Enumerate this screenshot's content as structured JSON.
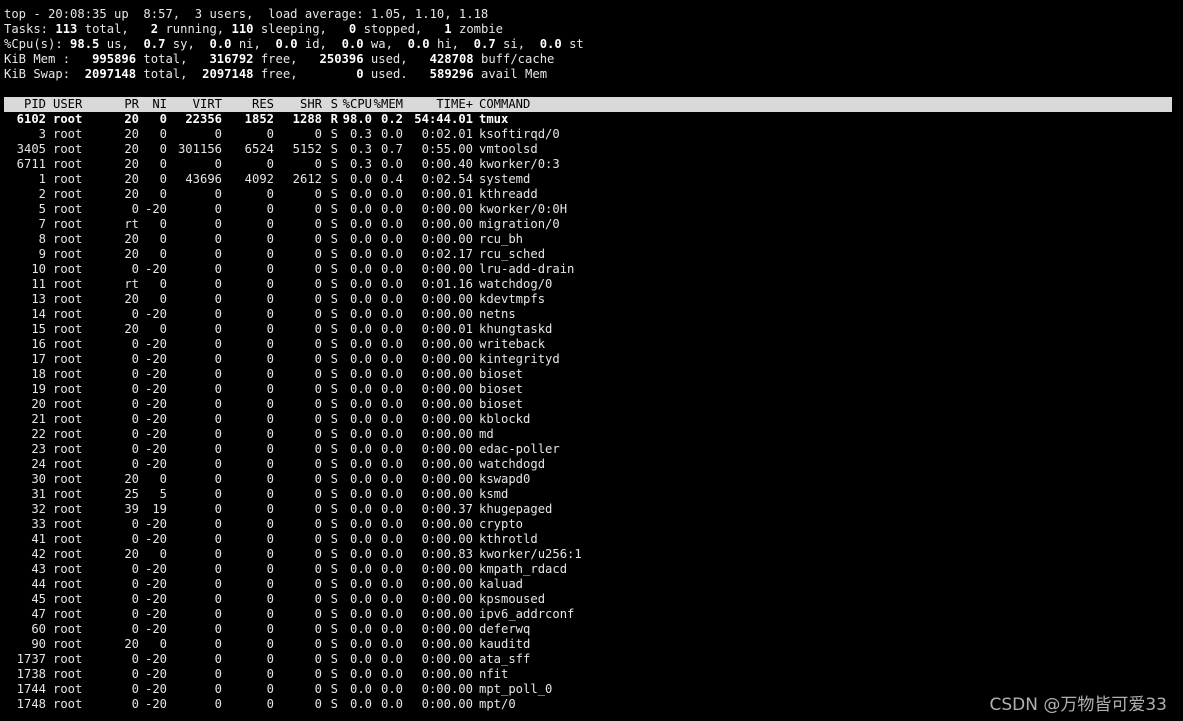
{
  "summary": {
    "l1": "top - 20:08:35 up  8:57,  3 users,  load average: 1.05, 1.10, 1.18",
    "l2": {
      "a": "Tasks: ",
      "total": "113",
      "b": " total,   ",
      "running": "2",
      "c": " running, ",
      "sleeping": "110",
      "d": " sleeping,   ",
      "stopped": "0",
      "e": " stopped,   ",
      "zombie": "1",
      "f": " zombie"
    },
    "l3": {
      "a": "%Cpu(s): ",
      "us": "98.5",
      "b": " us,  ",
      "sy": "0.7",
      "c": " sy,  ",
      "ni": "0.0",
      "d": " ni,  ",
      "id": "0.0",
      "e": " id,  ",
      "wa": "0.0",
      "f": " wa,  ",
      "hi": "0.0",
      "g": " hi,  ",
      "si": "0.7",
      "h": " si,  ",
      "st": "0.0",
      "i": " st"
    },
    "l4": {
      "a": "KiB Mem :   ",
      "total": "995896",
      "b": " total,   ",
      "free": "316792",
      "c": " free,   ",
      "used": "250396",
      "d": " used,   ",
      "cache": "428708",
      "e": " buff/cache"
    },
    "l5": {
      "a": "KiB Swap:  ",
      "total": "2097148",
      "b": " total,  ",
      "free": "2097148",
      "c": " free,        ",
      "used": "0",
      "d": " used.   ",
      "avail": "589296",
      "e": " avail Mem"
    }
  },
  "columns": {
    "pid": "PID",
    "user": "USER",
    "pr": "PR",
    "ni": "NI",
    "virt": "VIRT",
    "res": "RES",
    "shr": "SHR",
    "s": "S",
    "cpu": "%CPU",
    "mem": "%MEM",
    "time": "TIME+",
    "cmd": "COMMAND"
  },
  "processes": [
    [
      "6102",
      "root",
      "20",
      "0",
      "22356",
      "1852",
      "1288",
      "R",
      "98.0",
      "0.2",
      "54:44.01",
      "tmux"
    ],
    [
      "3",
      "root",
      "20",
      "0",
      "0",
      "0",
      "0",
      "S",
      "0.3",
      "0.0",
      "0:02.01",
      "ksoftirqd/0"
    ],
    [
      "3405",
      "root",
      "20",
      "0",
      "301156",
      "6524",
      "5152",
      "S",
      "0.3",
      "0.7",
      "0:55.00",
      "vmtoolsd"
    ],
    [
      "6711",
      "root",
      "20",
      "0",
      "0",
      "0",
      "0",
      "S",
      "0.3",
      "0.0",
      "0:00.40",
      "kworker/0:3"
    ],
    [
      "1",
      "root",
      "20",
      "0",
      "43696",
      "4092",
      "2612",
      "S",
      "0.0",
      "0.4",
      "0:02.54",
      "systemd"
    ],
    [
      "2",
      "root",
      "20",
      "0",
      "0",
      "0",
      "0",
      "S",
      "0.0",
      "0.0",
      "0:00.01",
      "kthreadd"
    ],
    [
      "5",
      "root",
      "0",
      "-20",
      "0",
      "0",
      "0",
      "S",
      "0.0",
      "0.0",
      "0:00.00",
      "kworker/0:0H"
    ],
    [
      "7",
      "root",
      "rt",
      "0",
      "0",
      "0",
      "0",
      "S",
      "0.0",
      "0.0",
      "0:00.00",
      "migration/0"
    ],
    [
      "8",
      "root",
      "20",
      "0",
      "0",
      "0",
      "0",
      "S",
      "0.0",
      "0.0",
      "0:00.00",
      "rcu_bh"
    ],
    [
      "9",
      "root",
      "20",
      "0",
      "0",
      "0",
      "0",
      "S",
      "0.0",
      "0.0",
      "0:02.17",
      "rcu_sched"
    ],
    [
      "10",
      "root",
      "0",
      "-20",
      "0",
      "0",
      "0",
      "S",
      "0.0",
      "0.0",
      "0:00.00",
      "lru-add-drain"
    ],
    [
      "11",
      "root",
      "rt",
      "0",
      "0",
      "0",
      "0",
      "S",
      "0.0",
      "0.0",
      "0:01.16",
      "watchdog/0"
    ],
    [
      "13",
      "root",
      "20",
      "0",
      "0",
      "0",
      "0",
      "S",
      "0.0",
      "0.0",
      "0:00.00",
      "kdevtmpfs"
    ],
    [
      "14",
      "root",
      "0",
      "-20",
      "0",
      "0",
      "0",
      "S",
      "0.0",
      "0.0",
      "0:00.00",
      "netns"
    ],
    [
      "15",
      "root",
      "20",
      "0",
      "0",
      "0",
      "0",
      "S",
      "0.0",
      "0.0",
      "0:00.01",
      "khungtaskd"
    ],
    [
      "16",
      "root",
      "0",
      "-20",
      "0",
      "0",
      "0",
      "S",
      "0.0",
      "0.0",
      "0:00.00",
      "writeback"
    ],
    [
      "17",
      "root",
      "0",
      "-20",
      "0",
      "0",
      "0",
      "S",
      "0.0",
      "0.0",
      "0:00.00",
      "kintegrityd"
    ],
    [
      "18",
      "root",
      "0",
      "-20",
      "0",
      "0",
      "0",
      "S",
      "0.0",
      "0.0",
      "0:00.00",
      "bioset"
    ],
    [
      "19",
      "root",
      "0",
      "-20",
      "0",
      "0",
      "0",
      "S",
      "0.0",
      "0.0",
      "0:00.00",
      "bioset"
    ],
    [
      "20",
      "root",
      "0",
      "-20",
      "0",
      "0",
      "0",
      "S",
      "0.0",
      "0.0",
      "0:00.00",
      "bioset"
    ],
    [
      "21",
      "root",
      "0",
      "-20",
      "0",
      "0",
      "0",
      "S",
      "0.0",
      "0.0",
      "0:00.00",
      "kblockd"
    ],
    [
      "22",
      "root",
      "0",
      "-20",
      "0",
      "0",
      "0",
      "S",
      "0.0",
      "0.0",
      "0:00.00",
      "md"
    ],
    [
      "23",
      "root",
      "0",
      "-20",
      "0",
      "0",
      "0",
      "S",
      "0.0",
      "0.0",
      "0:00.00",
      "edac-poller"
    ],
    [
      "24",
      "root",
      "0",
      "-20",
      "0",
      "0",
      "0",
      "S",
      "0.0",
      "0.0",
      "0:00.00",
      "watchdogd"
    ],
    [
      "30",
      "root",
      "20",
      "0",
      "0",
      "0",
      "0",
      "S",
      "0.0",
      "0.0",
      "0:00.00",
      "kswapd0"
    ],
    [
      "31",
      "root",
      "25",
      "5",
      "0",
      "0",
      "0",
      "S",
      "0.0",
      "0.0",
      "0:00.00",
      "ksmd"
    ],
    [
      "32",
      "root",
      "39",
      "19",
      "0",
      "0",
      "0",
      "S",
      "0.0",
      "0.0",
      "0:00.37",
      "khugepaged"
    ],
    [
      "33",
      "root",
      "0",
      "-20",
      "0",
      "0",
      "0",
      "S",
      "0.0",
      "0.0",
      "0:00.00",
      "crypto"
    ],
    [
      "41",
      "root",
      "0",
      "-20",
      "0",
      "0",
      "0",
      "S",
      "0.0",
      "0.0",
      "0:00.00",
      "kthrotld"
    ],
    [
      "42",
      "root",
      "20",
      "0",
      "0",
      "0",
      "0",
      "S",
      "0.0",
      "0.0",
      "0:00.83",
      "kworker/u256:1"
    ],
    [
      "43",
      "root",
      "0",
      "-20",
      "0",
      "0",
      "0",
      "S",
      "0.0",
      "0.0",
      "0:00.00",
      "kmpath_rdacd"
    ],
    [
      "44",
      "root",
      "0",
      "-20",
      "0",
      "0",
      "0",
      "S",
      "0.0",
      "0.0",
      "0:00.00",
      "kaluad"
    ],
    [
      "45",
      "root",
      "0",
      "-20",
      "0",
      "0",
      "0",
      "S",
      "0.0",
      "0.0",
      "0:00.00",
      "kpsmoused"
    ],
    [
      "47",
      "root",
      "0",
      "-20",
      "0",
      "0",
      "0",
      "S",
      "0.0",
      "0.0",
      "0:00.00",
      "ipv6_addrconf"
    ],
    [
      "60",
      "root",
      "0",
      "-20",
      "0",
      "0",
      "0",
      "S",
      "0.0",
      "0.0",
      "0:00.00",
      "deferwq"
    ],
    [
      "90",
      "root",
      "20",
      "0",
      "0",
      "0",
      "0",
      "S",
      "0.0",
      "0.0",
      "0:00.00",
      "kauditd"
    ],
    [
      "1737",
      "root",
      "0",
      "-20",
      "0",
      "0",
      "0",
      "S",
      "0.0",
      "0.0",
      "0:00.00",
      "ata_sff"
    ],
    [
      "1738",
      "root",
      "0",
      "-20",
      "0",
      "0",
      "0",
      "S",
      "0.0",
      "0.0",
      "0:00.00",
      "nfit"
    ],
    [
      "1744",
      "root",
      "0",
      "-20",
      "0",
      "0",
      "0",
      "S",
      "0.0",
      "0.0",
      "0:00.00",
      "mpt_poll_0"
    ],
    [
      "1748",
      "root",
      "0",
      "-20",
      "0",
      "0",
      "0",
      "S",
      "0.0",
      "0.0",
      "0:00.00",
      "mpt/0"
    ]
  ],
  "watermark": "CSDN @万物皆可爱33"
}
